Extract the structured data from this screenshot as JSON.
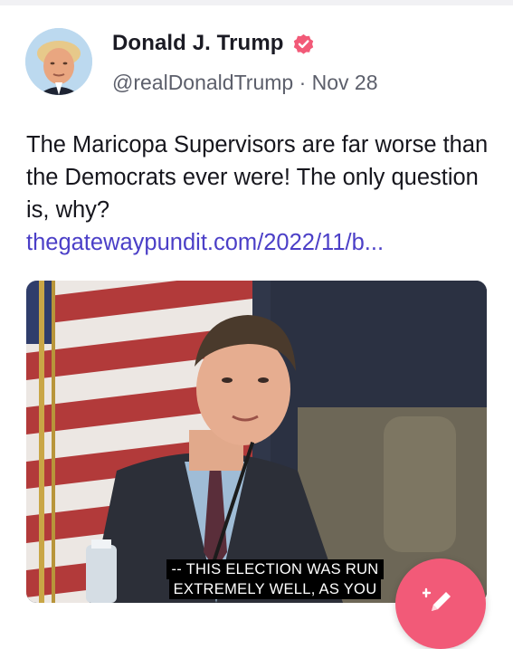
{
  "post": {
    "display_name": "Donald J. Trump",
    "handle": "@realDonaldTrump",
    "separator": "·",
    "date": "Nov 28",
    "text": "The Maricopa Supervisors are far worse than the Democrats ever were! The only question is, why?",
    "link": "thegatewaypundit.com/2022/11/b..."
  },
  "media": {
    "caption_line1": "-- THIS ELECTION WAS RUN",
    "caption_line2": "EXTREMELY WELL, AS YOU"
  },
  "colors": {
    "verified_badge": "#f25a78",
    "link": "#4b3fc7",
    "compose_button": "#f25a78"
  },
  "icons": {
    "verified": "verified-badge-icon",
    "compose": "compose-pencil-icon"
  }
}
